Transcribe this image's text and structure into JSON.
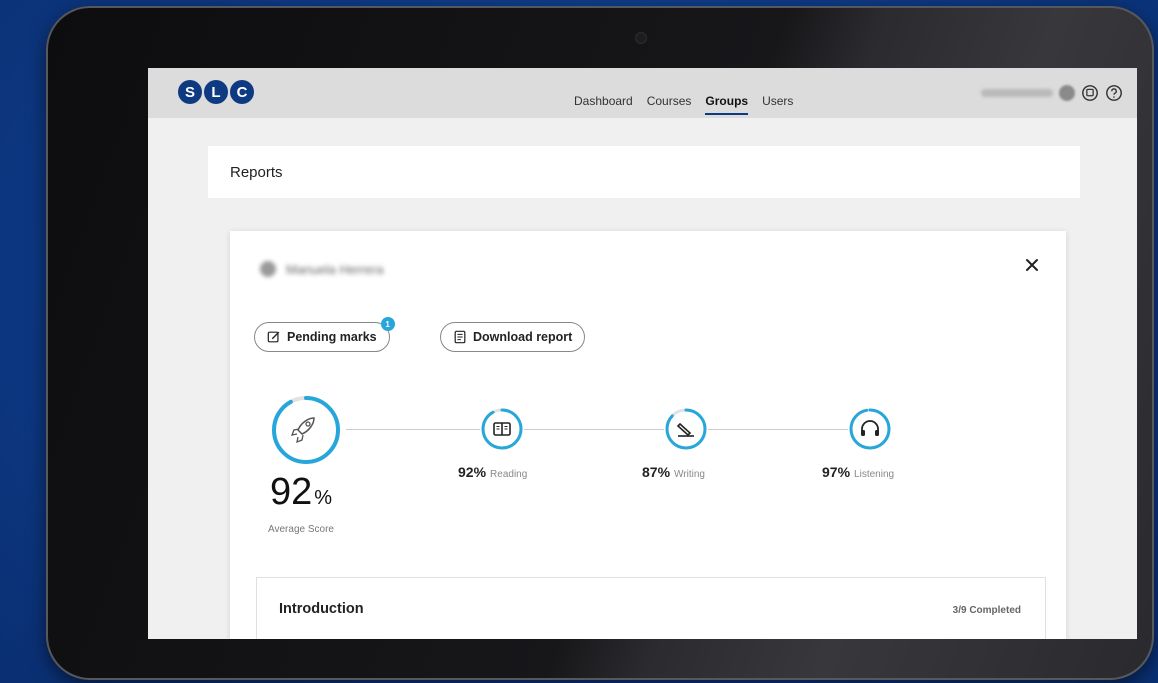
{
  "app": {
    "logo_letters": [
      "S",
      "L",
      "C"
    ],
    "brand_color": "#0e3a82",
    "accent_color": "#27a6db"
  },
  "nav": {
    "items": [
      {
        "label": "Dashboard",
        "active": false
      },
      {
        "label": "Courses",
        "active": false
      },
      {
        "label": "Groups",
        "active": true
      },
      {
        "label": "Users",
        "active": false
      }
    ]
  },
  "header_icons": [
    "chat-icon",
    "help-icon"
  ],
  "page": {
    "title": "Reports"
  },
  "report": {
    "student_name": "Manuela Herrera",
    "buttons": {
      "pending_marks": "Pending marks",
      "pending_badge": "1",
      "download_report": "Download report"
    },
    "average": {
      "value": "92",
      "unit": "%",
      "label": "Average Score",
      "progress": 0.92
    },
    "skills": [
      {
        "icon": "book-icon",
        "value": "92%",
        "label": "Reading",
        "progress": 0.92
      },
      {
        "icon": "pen-icon",
        "value": "87%",
        "label": "Writing",
        "progress": 0.87
      },
      {
        "icon": "headphones-icon",
        "value": "97%",
        "label": "Listening",
        "progress": 0.97
      }
    ],
    "section": {
      "title": "Introduction",
      "status": "3/9 Completed"
    }
  }
}
